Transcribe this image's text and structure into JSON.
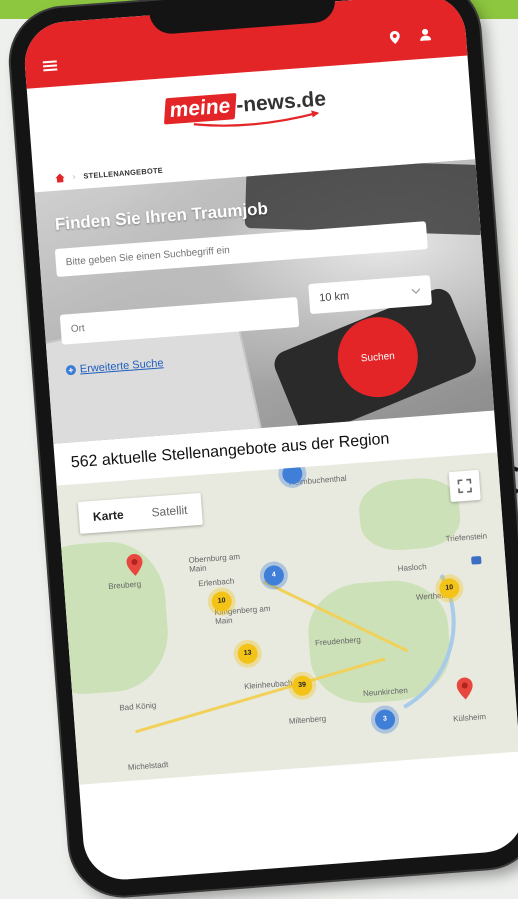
{
  "app": {
    "logo_main": "meine",
    "logo_rest": "-news.de"
  },
  "breadcrumb": {
    "label": "STELLENANGEBOTE"
  },
  "search": {
    "title": "Finden Sie Ihren Traumjob",
    "query_placeholder": "Bitte geben Sie einen Suchbegriff ein",
    "place_placeholder": "Ort",
    "radius_value": "10 km",
    "advanced_label": "Erweiterte Suche",
    "submit_label": "Suchen"
  },
  "results": {
    "count_title": "562 aktuelle Stellenangebote aus der Region"
  },
  "map": {
    "tabs": [
      "Karte",
      "Satellit"
    ],
    "active_tab": "Karte",
    "towns": [
      "Heimbuchenthal",
      "Obernburg am Main",
      "Erlenbach",
      "Klingenberg am Main",
      "Breuberg",
      "Hasloch",
      "Wertheim",
      "Freudenberg",
      "Kleinheubach",
      "Miltenberg",
      "Bad König",
      "Neunkirchen",
      "Külsheim",
      "Michelstadt",
      "Triefenstein"
    ],
    "clusters": [
      {
        "label": "10",
        "color": "yellow"
      },
      {
        "label": "4",
        "color": "blue"
      },
      {
        "label": "13",
        "color": "yellow"
      },
      {
        "label": "39",
        "color": "yellow"
      },
      {
        "label": "10",
        "color": "yellow"
      },
      {
        "label": "3",
        "color": "blue"
      }
    ]
  },
  "colors": {
    "brand_red": "#e42527",
    "top_bar_green": "#8dc63f"
  },
  "icons": [
    "menu-icon",
    "location-pin-icon",
    "user-icon",
    "home-icon",
    "chevron-down-icon",
    "plus-circle-icon",
    "fullscreen-icon",
    "map-marker-icon"
  ]
}
